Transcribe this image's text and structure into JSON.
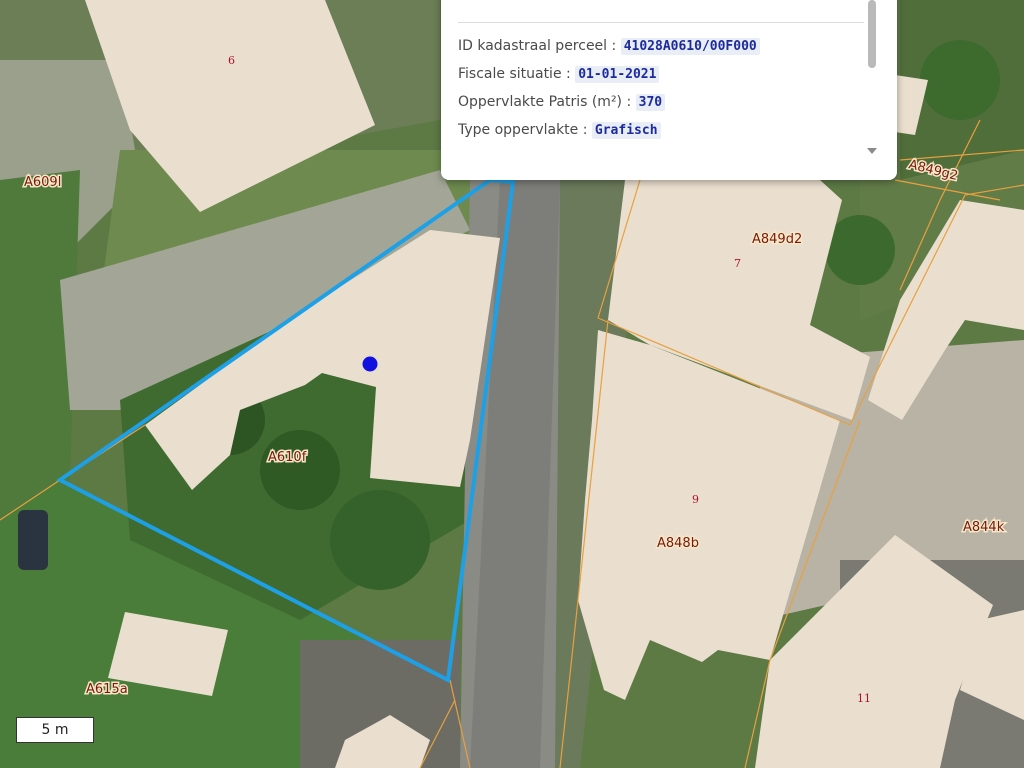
{
  "popup": {
    "rows": [
      {
        "label": "ID kadastraal perceel :",
        "value": "41028A0610/00F000"
      },
      {
        "label": "Fiscale situatie :",
        "value": "01-01-2021"
      },
      {
        "label": "Oppervlakte Patris (m²) :",
        "value": "370"
      },
      {
        "label": "Type oppervlakte :",
        "value": "Grafisch"
      }
    ]
  },
  "parcels": {
    "a609l": "A609l",
    "a610f": "A610f",
    "a615a": "A615a",
    "a849d2": "A849d2",
    "a849g2": "A849g2",
    "a848b": "A848b",
    "a844k": "A844k"
  },
  "house_numbers": {
    "n6": "6",
    "n7": "7",
    "n9": "9",
    "n11": "11"
  },
  "scale": {
    "label": "5 m"
  },
  "colors": {
    "selection_outline": "#1ea0e6",
    "marker": "#1010e0",
    "building_fill": "#eadfcf",
    "parcel_line": "#e8a040"
  }
}
